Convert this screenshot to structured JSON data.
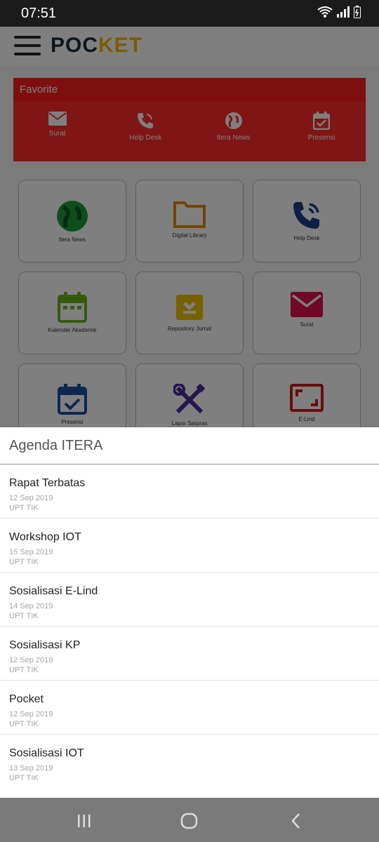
{
  "status": {
    "time": "07:51"
  },
  "app": {
    "title_left": "POC",
    "title_right": "KET",
    "favorite": {
      "title": "Favorite",
      "items": [
        {
          "label": "Surat",
          "icon": "mail-icon"
        },
        {
          "label": "Help Desk",
          "icon": "phone-icon"
        },
        {
          "label": "Itera News",
          "icon": "globe-icon"
        },
        {
          "label": "Presensi",
          "icon": "calendar-check-icon"
        }
      ]
    },
    "tiles": [
      {
        "label": "Itera News",
        "icon": "globe-icon",
        "color": "#1e9a3b"
      },
      {
        "label": "Digital Library",
        "icon": "folder-icon",
        "color": "#e78b00"
      },
      {
        "label": "Help Desk",
        "icon": "phone-icon",
        "color": "#1c3f8a"
      },
      {
        "label": "Kalender Akademik",
        "icon": "calendar-icon",
        "color": "#6ab41c"
      },
      {
        "label": "Repository Jurnal",
        "icon": "archive-icon",
        "color": "#f0c200"
      },
      {
        "label": "Surat",
        "icon": "mail-icon",
        "color": "#e0114e"
      },
      {
        "label": "Presensi",
        "icon": "calendar-check-icon",
        "color": "#1a4fa0"
      },
      {
        "label": "Lapor Sarpras",
        "icon": "tools-icon",
        "color": "#4a2b9a"
      },
      {
        "label": "E-Lind",
        "icon": "frame-icon",
        "color": "#d11a1a"
      }
    ]
  },
  "agenda": {
    "title": "Agenda ITERA",
    "items": [
      {
        "title": "Rapat Terbatas",
        "date": "12 Sep 2019",
        "org": "UPT TIK"
      },
      {
        "title": "Workshop IOT",
        "date": "15 Sep 2019",
        "org": "UPT TIK"
      },
      {
        "title": "Sosialisasi E-Lind",
        "date": "14 Sep 2019",
        "org": "UPT TIK"
      },
      {
        "title": "Sosialisasi KP",
        "date": "12 Sep 2019",
        "org": "UPT TIK"
      },
      {
        "title": "Pocket",
        "date": "12 Sep 2019",
        "org": "UPT TIK"
      },
      {
        "title": "Sosialisasi IOT",
        "date": "13 Sep 2019",
        "org": "UPT TIK"
      }
    ]
  },
  "navbar": {
    "buttons": [
      "recents-icon",
      "home-icon",
      "back-icon"
    ]
  }
}
